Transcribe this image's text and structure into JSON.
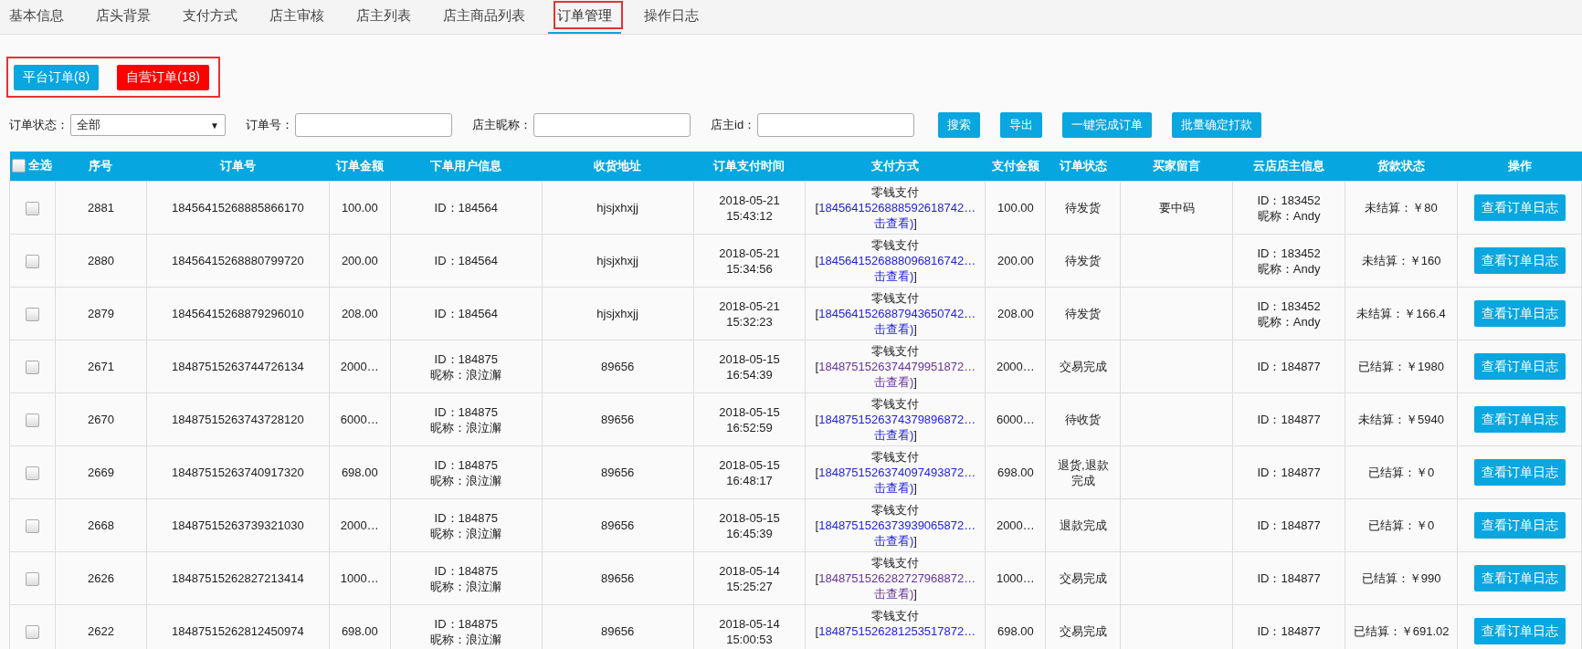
{
  "tabs": [
    {
      "label": "基本信息",
      "selected": false,
      "highlighted": false
    },
    {
      "label": "店头背景",
      "selected": false,
      "highlighted": false
    },
    {
      "label": "支付方式",
      "selected": false,
      "highlighted": false
    },
    {
      "label": "店主审核",
      "selected": false,
      "highlighted": false
    },
    {
      "label": "店主列表",
      "selected": false,
      "highlighted": false
    },
    {
      "label": "店主商品列表",
      "selected": false,
      "highlighted": false
    },
    {
      "label": "订单管理",
      "selected": true,
      "highlighted": true
    },
    {
      "label": "操作日志",
      "selected": false,
      "highlighted": false
    }
  ],
  "order_types": {
    "highlighted": true,
    "buttons": [
      {
        "label": "平台订单(8)",
        "selected": false
      },
      {
        "label": "自营订单(18)",
        "selected": true
      }
    ]
  },
  "filters": [
    {
      "kind": "select",
      "label": "订单状态：",
      "value": "全部",
      "caret": "▼"
    },
    {
      "kind": "input",
      "label": "订单号："
    },
    {
      "kind": "input",
      "label": "店主昵称："
    },
    {
      "kind": "input",
      "label": "店主id："
    }
  ],
  "actions": [
    "搜索",
    "导出",
    "一键完成订单",
    "批量确定打款"
  ],
  "table": {
    "select_all": {
      "label": "全选",
      "checked": false
    },
    "columns": [
      "序号",
      "订单号",
      "订单金额",
      "下单用户信息",
      "收货地址",
      "订单支付时间",
      "支付方式",
      "支付金额",
      "订单状态",
      "买家留言",
      "云店店主信息",
      "货款状态",
      "操作"
    ],
    "rows": [
      {
        "checked": false,
        "seq": "2881",
        "order_no": "18456415268885866170",
        "amount": "100.00",
        "user": [
          "ID：184564"
        ],
        "address": "hjsjxhxjj",
        "time": [
          "2018-05-21",
          "15:43:12"
        ],
        "payment": {
          "method": "零钱支付",
          "open": "[",
          "link": [
            "1845641526888592618742…",
            "击查看)"
          ],
          "close": "]",
          "visited": false
        },
        "paid": "100.00",
        "status": "待发货",
        "message": "要中码",
        "owner": [
          "ID：183452",
          "昵称：Andy"
        ],
        "payout": "未结算：￥80",
        "action": "查看订单日志"
      },
      {
        "checked": false,
        "seq": "2880",
        "order_no": "18456415268880799720",
        "amount": "200.00",
        "user": [
          "ID：184564"
        ],
        "address": "hjsjxhxjj",
        "time": [
          "2018-05-21",
          "15:34:56"
        ],
        "payment": {
          "method": "零钱支付",
          "open": "[",
          "link": [
            "1845641526888096816742…",
            "击查看)"
          ],
          "close": "]",
          "visited": false
        },
        "paid": "200.00",
        "status": "待发货",
        "owner": [
          "ID：183452",
          "昵称：Andy"
        ],
        "payout": "未结算：￥160",
        "action": "查看订单日志"
      },
      {
        "checked": false,
        "seq": "2879",
        "order_no": "18456415268879296010",
        "amount": "208.00",
        "user": [
          "ID：184564"
        ],
        "address": "hjsjxhxjj",
        "time": [
          "2018-05-21",
          "15:32:23"
        ],
        "payment": {
          "method": "零钱支付",
          "open": "[",
          "link": [
            "1845641526887943650742…",
            "击查看)"
          ],
          "close": "]",
          "visited": false
        },
        "paid": "208.00",
        "status": "待发货",
        "owner": [
          "ID：183452",
          "昵称：Andy"
        ],
        "payout": "未结算：￥166.4",
        "action": "查看订单日志"
      },
      {
        "checked": false,
        "seq": "2671",
        "order_no": "18487515263744726134",
        "amount": "2000…",
        "user": [
          "ID：184875",
          "昵称：浪泣澥"
        ],
        "address": "89656",
        "time": [
          "2018-05-15",
          "16:54:39"
        ],
        "payment": {
          "method": "零钱支付",
          "open": "[",
          "link": [
            "1848751526374479951872…",
            "击查看)"
          ],
          "close": "]",
          "visited": true
        },
        "paid": "2000…",
        "status": "交易完成",
        "owner": [
          "ID：184877"
        ],
        "payout": "已结算：￥1980",
        "action": "查看订单日志"
      },
      {
        "checked": false,
        "seq": "2670",
        "order_no": "18487515263743728120",
        "amount": "6000…",
        "user": [
          "ID：184875",
          "昵称：浪泣澥"
        ],
        "address": "89656",
        "time": [
          "2018-05-15",
          "16:52:59"
        ],
        "payment": {
          "method": "零钱支付",
          "open": "[",
          "link": [
            "1848751526374379896872…",
            "击查看)"
          ],
          "close": "]",
          "visited": false
        },
        "paid": "6000…",
        "status": "待收货",
        "owner": [
          "ID：184877"
        ],
        "payout": "未结算：￥5940",
        "action": "查看订单日志"
      },
      {
        "checked": false,
        "seq": "2669",
        "order_no": "18487515263740917320",
        "amount": "698.00",
        "user": [
          "ID：184875",
          "昵称：浪泣澥"
        ],
        "address": "89656",
        "time": [
          "2018-05-15",
          "16:48:17"
        ],
        "payment": {
          "method": "零钱支付",
          "open": "[",
          "link": [
            "1848751526374097493872…",
            "击查看)"
          ],
          "close": "]",
          "visited": false
        },
        "paid": "698.00",
        "status": "退货,退款完成",
        "owner": [
          "ID：184877"
        ],
        "payout": "已结算：￥0",
        "action": "查看订单日志"
      },
      {
        "checked": false,
        "seq": "2668",
        "order_no": "18487515263739321030",
        "amount": "2000…",
        "user": [
          "ID：184875",
          "昵称：浪泣澥"
        ],
        "address": "89656",
        "time": [
          "2018-05-15",
          "16:45:39"
        ],
        "payment": {
          "method": "零钱支付",
          "open": "[",
          "link": [
            "1848751526373939065872…",
            "击查看)"
          ],
          "close": "]",
          "visited": false
        },
        "paid": "2000…",
        "status": "退款完成",
        "owner": [
          "ID：184877"
        ],
        "payout": "已结算：￥0",
        "action": "查看订单日志"
      },
      {
        "checked": false,
        "seq": "2626",
        "order_no": "18487515262827213414",
        "amount": "1000…",
        "user": [
          "ID：184875",
          "昵称：浪泣澥"
        ],
        "address": "89656",
        "time": [
          "2018-05-14",
          "15:25:27"
        ],
        "payment": {
          "method": "零钱支付",
          "open": "[",
          "link": [
            "1848751526282727968872…",
            "击查看)"
          ],
          "close": "]",
          "visited": true
        },
        "paid": "1000…",
        "status": "交易完成",
        "owner": [
          "ID：184877"
        ],
        "payout": "已结算：￥990",
        "action": "查看订单日志"
      },
      {
        "checked": false,
        "seq": "2622",
        "order_no": "18487515262812450974",
        "amount": "698.00",
        "user": [
          "ID：184875",
          "昵称：浪泣澥"
        ],
        "address": "89656",
        "time": [
          "2018-05-14",
          "15:00:53"
        ],
        "payment": {
          "method": "零钱支付",
          "open": "[",
          "link": [
            "1848751526281253517872…"
          ],
          "visited": false
        },
        "paid": "698.00",
        "status": "交易完成",
        "owner": [
          "ID：184877"
        ],
        "payout": "已结算：￥691.02",
        "action": "查看订单日志"
      }
    ]
  }
}
